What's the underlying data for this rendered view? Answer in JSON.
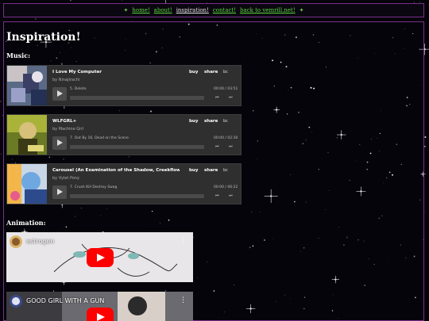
{
  "nav": {
    "links": [
      "home!",
      "about!",
      "inspiration!",
      "contact!",
      "back to vemrill.net!"
    ],
    "current": "inspiration!"
  },
  "page": {
    "title": "Inspiration!",
    "music_heading": "Music:",
    "animation_heading": "Animation:"
  },
  "players": [
    {
      "title": "I Love My Computer",
      "artist": "by Ninajirachi",
      "track": "5.  Delete",
      "time": "00:00 / 03:51",
      "buy": "buy",
      "share": "share",
      "logo": "bc"
    },
    {
      "title": "WLFGRL+",
      "artist": "by Machine Girl",
      "track": "7.  Out By 16, Dead on the Scene",
      "time": "00:00 / 02:30",
      "buy": "buy",
      "share": "share",
      "logo": "bc"
    },
    {
      "title": "Carousel (An Examination of the Shadow, Creekflow, and I...",
      "artist": "by Vylet Pony",
      "track": "7.  Crush Kill Destroy Swag",
      "time": "00:00 / 06:22",
      "buy": "buy",
      "share": "share",
      "logo": "bc"
    }
  ],
  "videos": [
    {
      "title": "estrogen"
    },
    {
      "title": "GOOD GIRL WITH A GUN"
    }
  ],
  "colors": {
    "nav_link": "#59d93c",
    "frame": "#7a2f8c",
    "player_bg": "#2f2f2f",
    "youtube_red": "#ff0000"
  }
}
